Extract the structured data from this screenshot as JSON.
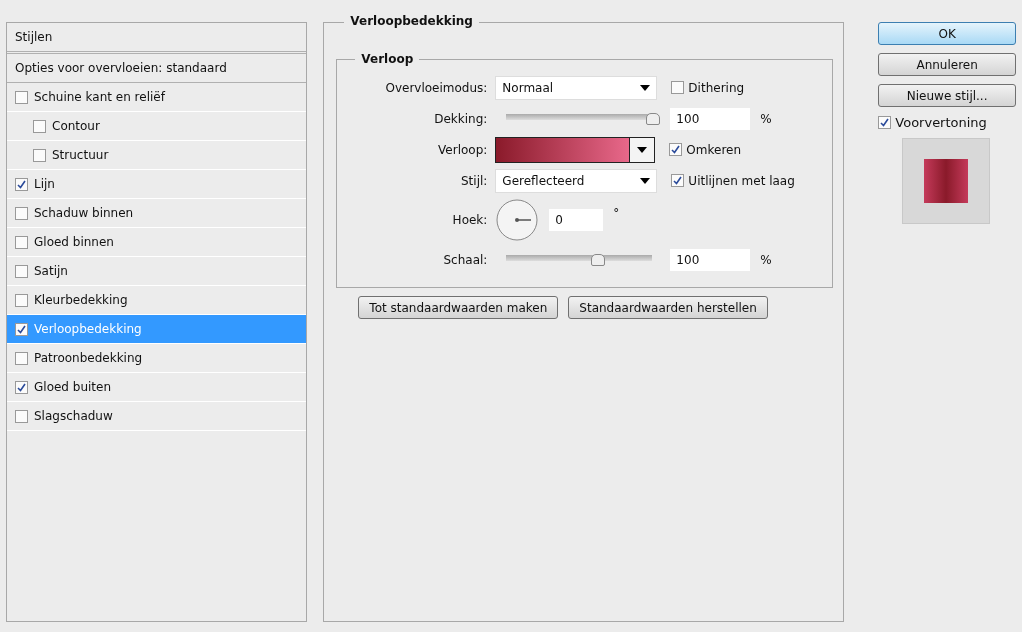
{
  "styles_panel": {
    "header": "Stijlen",
    "blending_options": "Opties voor overvloeien: standaard",
    "items": [
      {
        "label": "Schuine kant en reliëf",
        "checked": false,
        "selected": false,
        "children": [
          {
            "label": "Contour",
            "checked": false,
            "selected": false
          },
          {
            "label": "Structuur",
            "checked": false,
            "selected": false
          }
        ]
      },
      {
        "label": "Lijn",
        "checked": true,
        "selected": false
      },
      {
        "label": "Schaduw binnen",
        "checked": false,
        "selected": false
      },
      {
        "label": "Gloed binnen",
        "checked": false,
        "selected": false
      },
      {
        "label": "Satijn",
        "checked": false,
        "selected": false
      },
      {
        "label": "Kleurbedekking",
        "checked": false,
        "selected": false
      },
      {
        "label": "Verloopbedekking",
        "checked": true,
        "selected": true
      },
      {
        "label": "Patroonbedekking",
        "checked": false,
        "selected": false
      },
      {
        "label": "Gloed buiten",
        "checked": true,
        "selected": false
      },
      {
        "label": "Slagschaduw",
        "checked": false,
        "selected": false
      }
    ]
  },
  "settings": {
    "title": "Verloopbedekking",
    "group_title": "Verloop",
    "blend_mode": {
      "label": "Overvloeimodus:",
      "value": "Normaal"
    },
    "dither": {
      "label": "Dithering",
      "checked": false
    },
    "opacity": {
      "label": "Dekking:",
      "level": 1.0,
      "value": "100",
      "unit": "%"
    },
    "gradient": {
      "label": "Verloop:"
    },
    "reverse": {
      "label": "Omkeren",
      "checked": true
    },
    "style": {
      "label": "Stijl:",
      "value": "Gereflecteerd"
    },
    "align": {
      "label": "Uitlijnen met laag",
      "checked": true
    },
    "angle": {
      "label": "Hoek:",
      "value": "0",
      "unit": "°"
    },
    "scale": {
      "label": "Schaal:",
      "level": 0.62,
      "value": "100",
      "unit": "%"
    },
    "buttons": [
      "Tot standaardwaarden maken",
      "Standaardwaarden herstellen"
    ]
  },
  "actions": {
    "buttons": [
      {
        "label": "OK",
        "default": true
      },
      {
        "label": "Annuleren",
        "default": false
      },
      {
        "label": "Nieuwe stijl...",
        "default": false
      }
    ],
    "preview": {
      "label": "Voorvertoning",
      "checked": true
    }
  }
}
